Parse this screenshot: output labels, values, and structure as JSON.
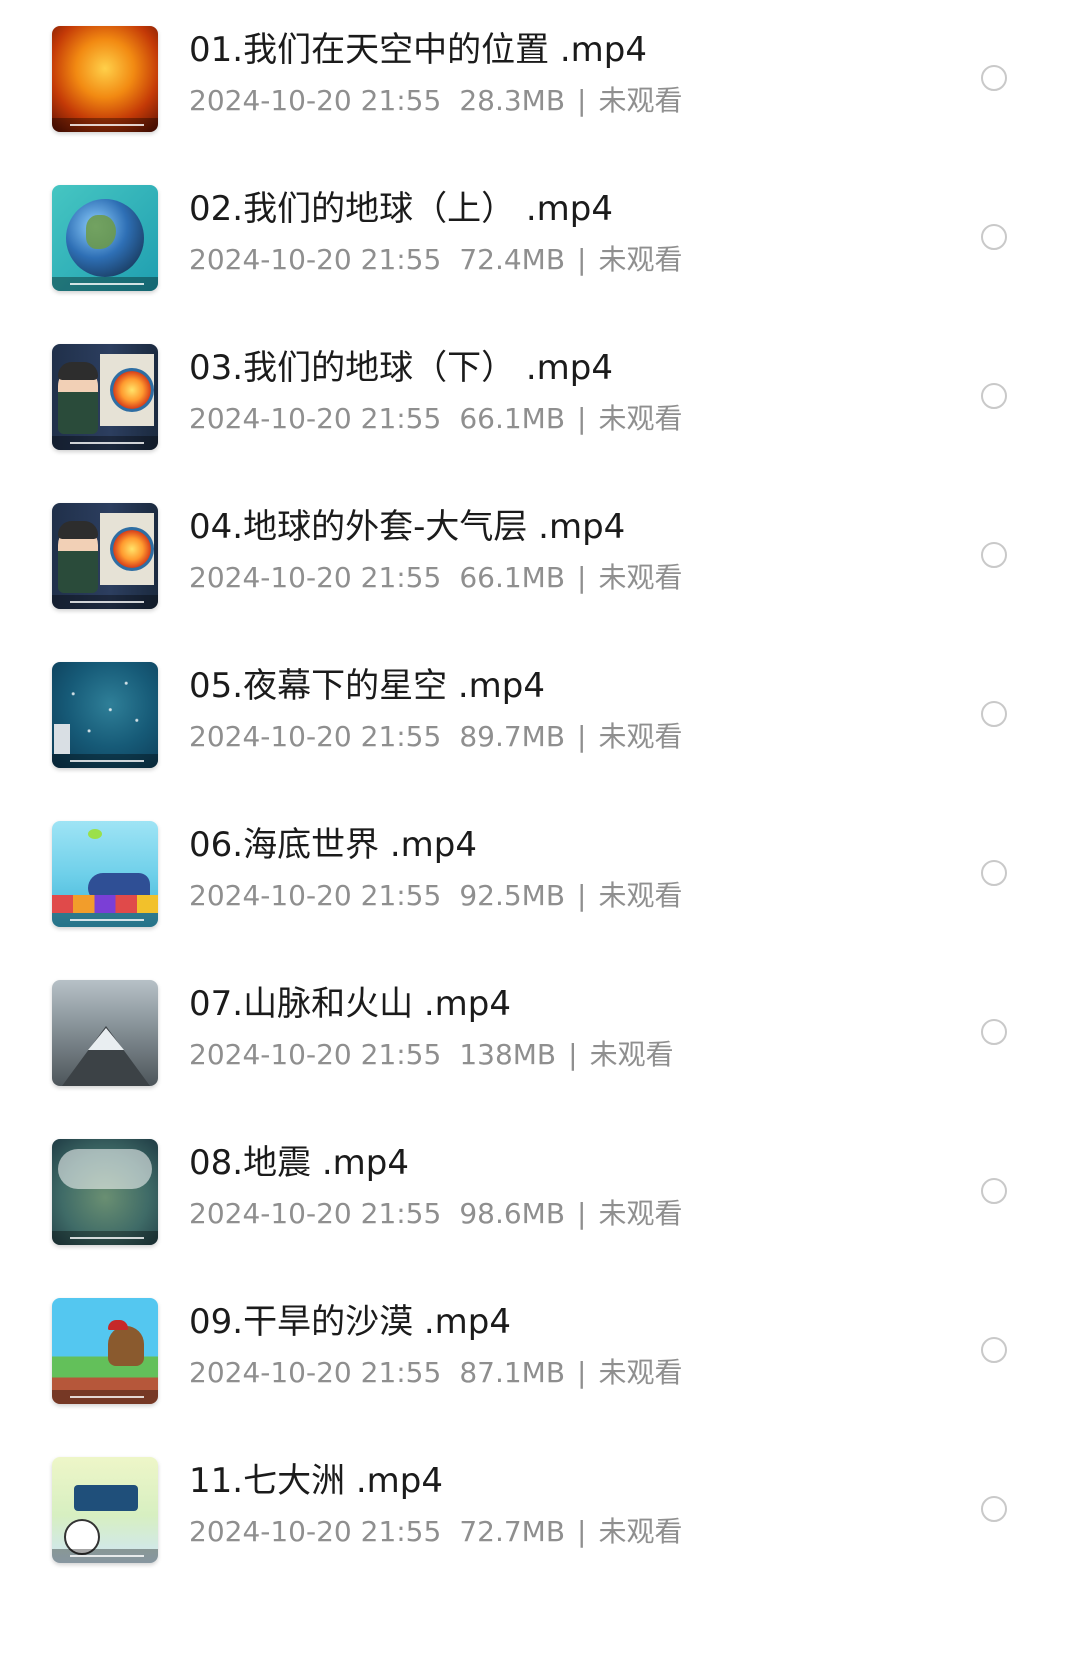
{
  "files": [
    {
      "title": "01.我们在天空中的位置 .mp4",
      "date": "2024-10-20 21:55",
      "size": "28.3MB",
      "status": "未观看",
      "thumb": "sun-thumbnail"
    },
    {
      "title": "02.我们的地球（上） .mp4",
      "date": "2024-10-20 21:55",
      "size": "72.4MB",
      "status": "未观看",
      "thumb": "earth-thumbnail"
    },
    {
      "title": "03.我们的地球（下） .mp4",
      "date": "2024-10-20 21:55",
      "size": "66.1MB",
      "status": "未观看",
      "thumb": "earth-core-thumbnail"
    },
    {
      "title": "04.地球的外套-大气层 .mp4",
      "date": "2024-10-20 21:55",
      "size": "66.1MB",
      "status": "未观看",
      "thumb": "earth-core-thumbnail"
    },
    {
      "title": "05.夜幕下的星空 .mp4",
      "date": "2024-10-20 21:55",
      "size": "89.7MB",
      "status": "未观看",
      "thumb": "night-sky-thumbnail"
    },
    {
      "title": "06.海底世界 .mp4",
      "date": "2024-10-20 21:55",
      "size": "92.5MB",
      "status": "未观看",
      "thumb": "sea-thumbnail"
    },
    {
      "title": "07.山脉和火山 .mp4",
      "date": "2024-10-20 21:55",
      "size": "138MB",
      "status": "未观看",
      "thumb": "mountain-thumbnail"
    },
    {
      "title": "08.地震 .mp4",
      "date": "2024-10-20 21:55",
      "size": "98.6MB",
      "status": "未观看",
      "thumb": "earthquake-thumbnail"
    },
    {
      "title": "09.干旱的沙漠 .mp4",
      "date": "2024-10-20 21:55",
      "size": "87.1MB",
      "status": "未观看",
      "thumb": "desert-thumbnail"
    },
    {
      "title": "11.七大洲 .mp4",
      "date": "2024-10-20 21:55",
      "size": "72.7MB",
      "status": "未观看",
      "thumb": "continents-thumbnail"
    }
  ],
  "separator": "|",
  "colors": {
    "title": "#1b1b1b",
    "meta": "#8f8f8f",
    "radio_border": "#c9c9c9",
    "background": "#ffffff"
  }
}
